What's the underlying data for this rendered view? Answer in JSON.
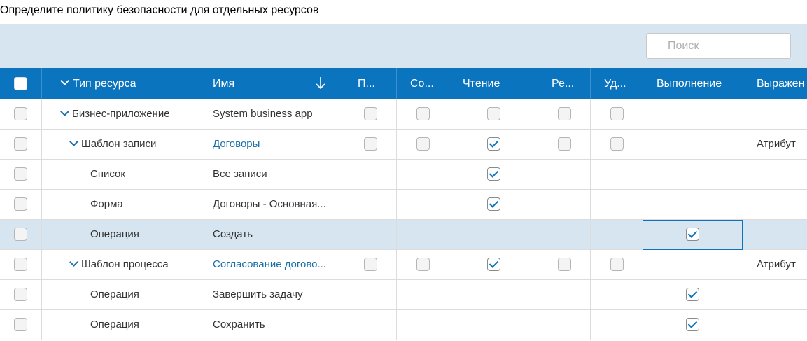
{
  "page_title": "Определите политику безопасности для отдельных ресурсов",
  "search": {
    "placeholder": "Поиск",
    "value": ""
  },
  "columns": [
    {
      "key": "select",
      "label": ""
    },
    {
      "key": "type",
      "label": "Тип ресурса"
    },
    {
      "key": "name",
      "label": "Имя"
    },
    {
      "key": "create",
      "label": "П..."
    },
    {
      "key": "save",
      "label": "Со..."
    },
    {
      "key": "read",
      "label": "Чтение"
    },
    {
      "key": "edit",
      "label": "Ре..."
    },
    {
      "key": "delete",
      "label": "Уд..."
    },
    {
      "key": "execute",
      "label": "Выполнение"
    },
    {
      "key": "expression",
      "label": "Выражен"
    }
  ],
  "rows": [
    {
      "type": "Бизнес-приложение",
      "name": "System business app",
      "name_is_link": false,
      "expander": true,
      "level": 0,
      "perms": {
        "create": false,
        "save": false,
        "read": false,
        "edit": false,
        "delete": false
      },
      "execute": null,
      "expression": ""
    },
    {
      "type": "Шаблон записи",
      "name": "Договоры",
      "name_is_link": true,
      "expander": true,
      "level": 1,
      "perms": {
        "create": false,
        "save": false,
        "read": true,
        "edit": false,
        "delete": false
      },
      "execute": null,
      "expression": "Атрибут"
    },
    {
      "type": "Список",
      "name": "Все записи",
      "name_is_link": false,
      "expander": false,
      "level": 2,
      "perms": {
        "read": true
      },
      "execute": null,
      "expression": ""
    },
    {
      "type": "Форма",
      "name": "Договоры - Основная...",
      "name_is_link": false,
      "expander": false,
      "level": 2,
      "perms": {
        "read": true
      },
      "execute": null,
      "expression": ""
    },
    {
      "type": "Операция",
      "name": "Создать",
      "name_is_link": false,
      "expander": false,
      "level": 2,
      "perms": {},
      "execute": true,
      "expression": "",
      "selected": true
    },
    {
      "type": "Шаблон процесса",
      "name": "Согласование догово...",
      "name_is_link": true,
      "expander": true,
      "level": 1,
      "perms": {
        "create": false,
        "save": false,
        "read": true,
        "edit": false,
        "delete": false
      },
      "execute": null,
      "expression": "Атрибут"
    },
    {
      "type": "Операция",
      "name": "Завершить задачу",
      "name_is_link": false,
      "expander": false,
      "level": 2,
      "perms": {},
      "execute": true,
      "expression": ""
    },
    {
      "type": "Операция",
      "name": "Сохранить",
      "name_is_link": false,
      "expander": false,
      "level": 2,
      "perms": {},
      "execute": true,
      "expression": ""
    }
  ]
}
